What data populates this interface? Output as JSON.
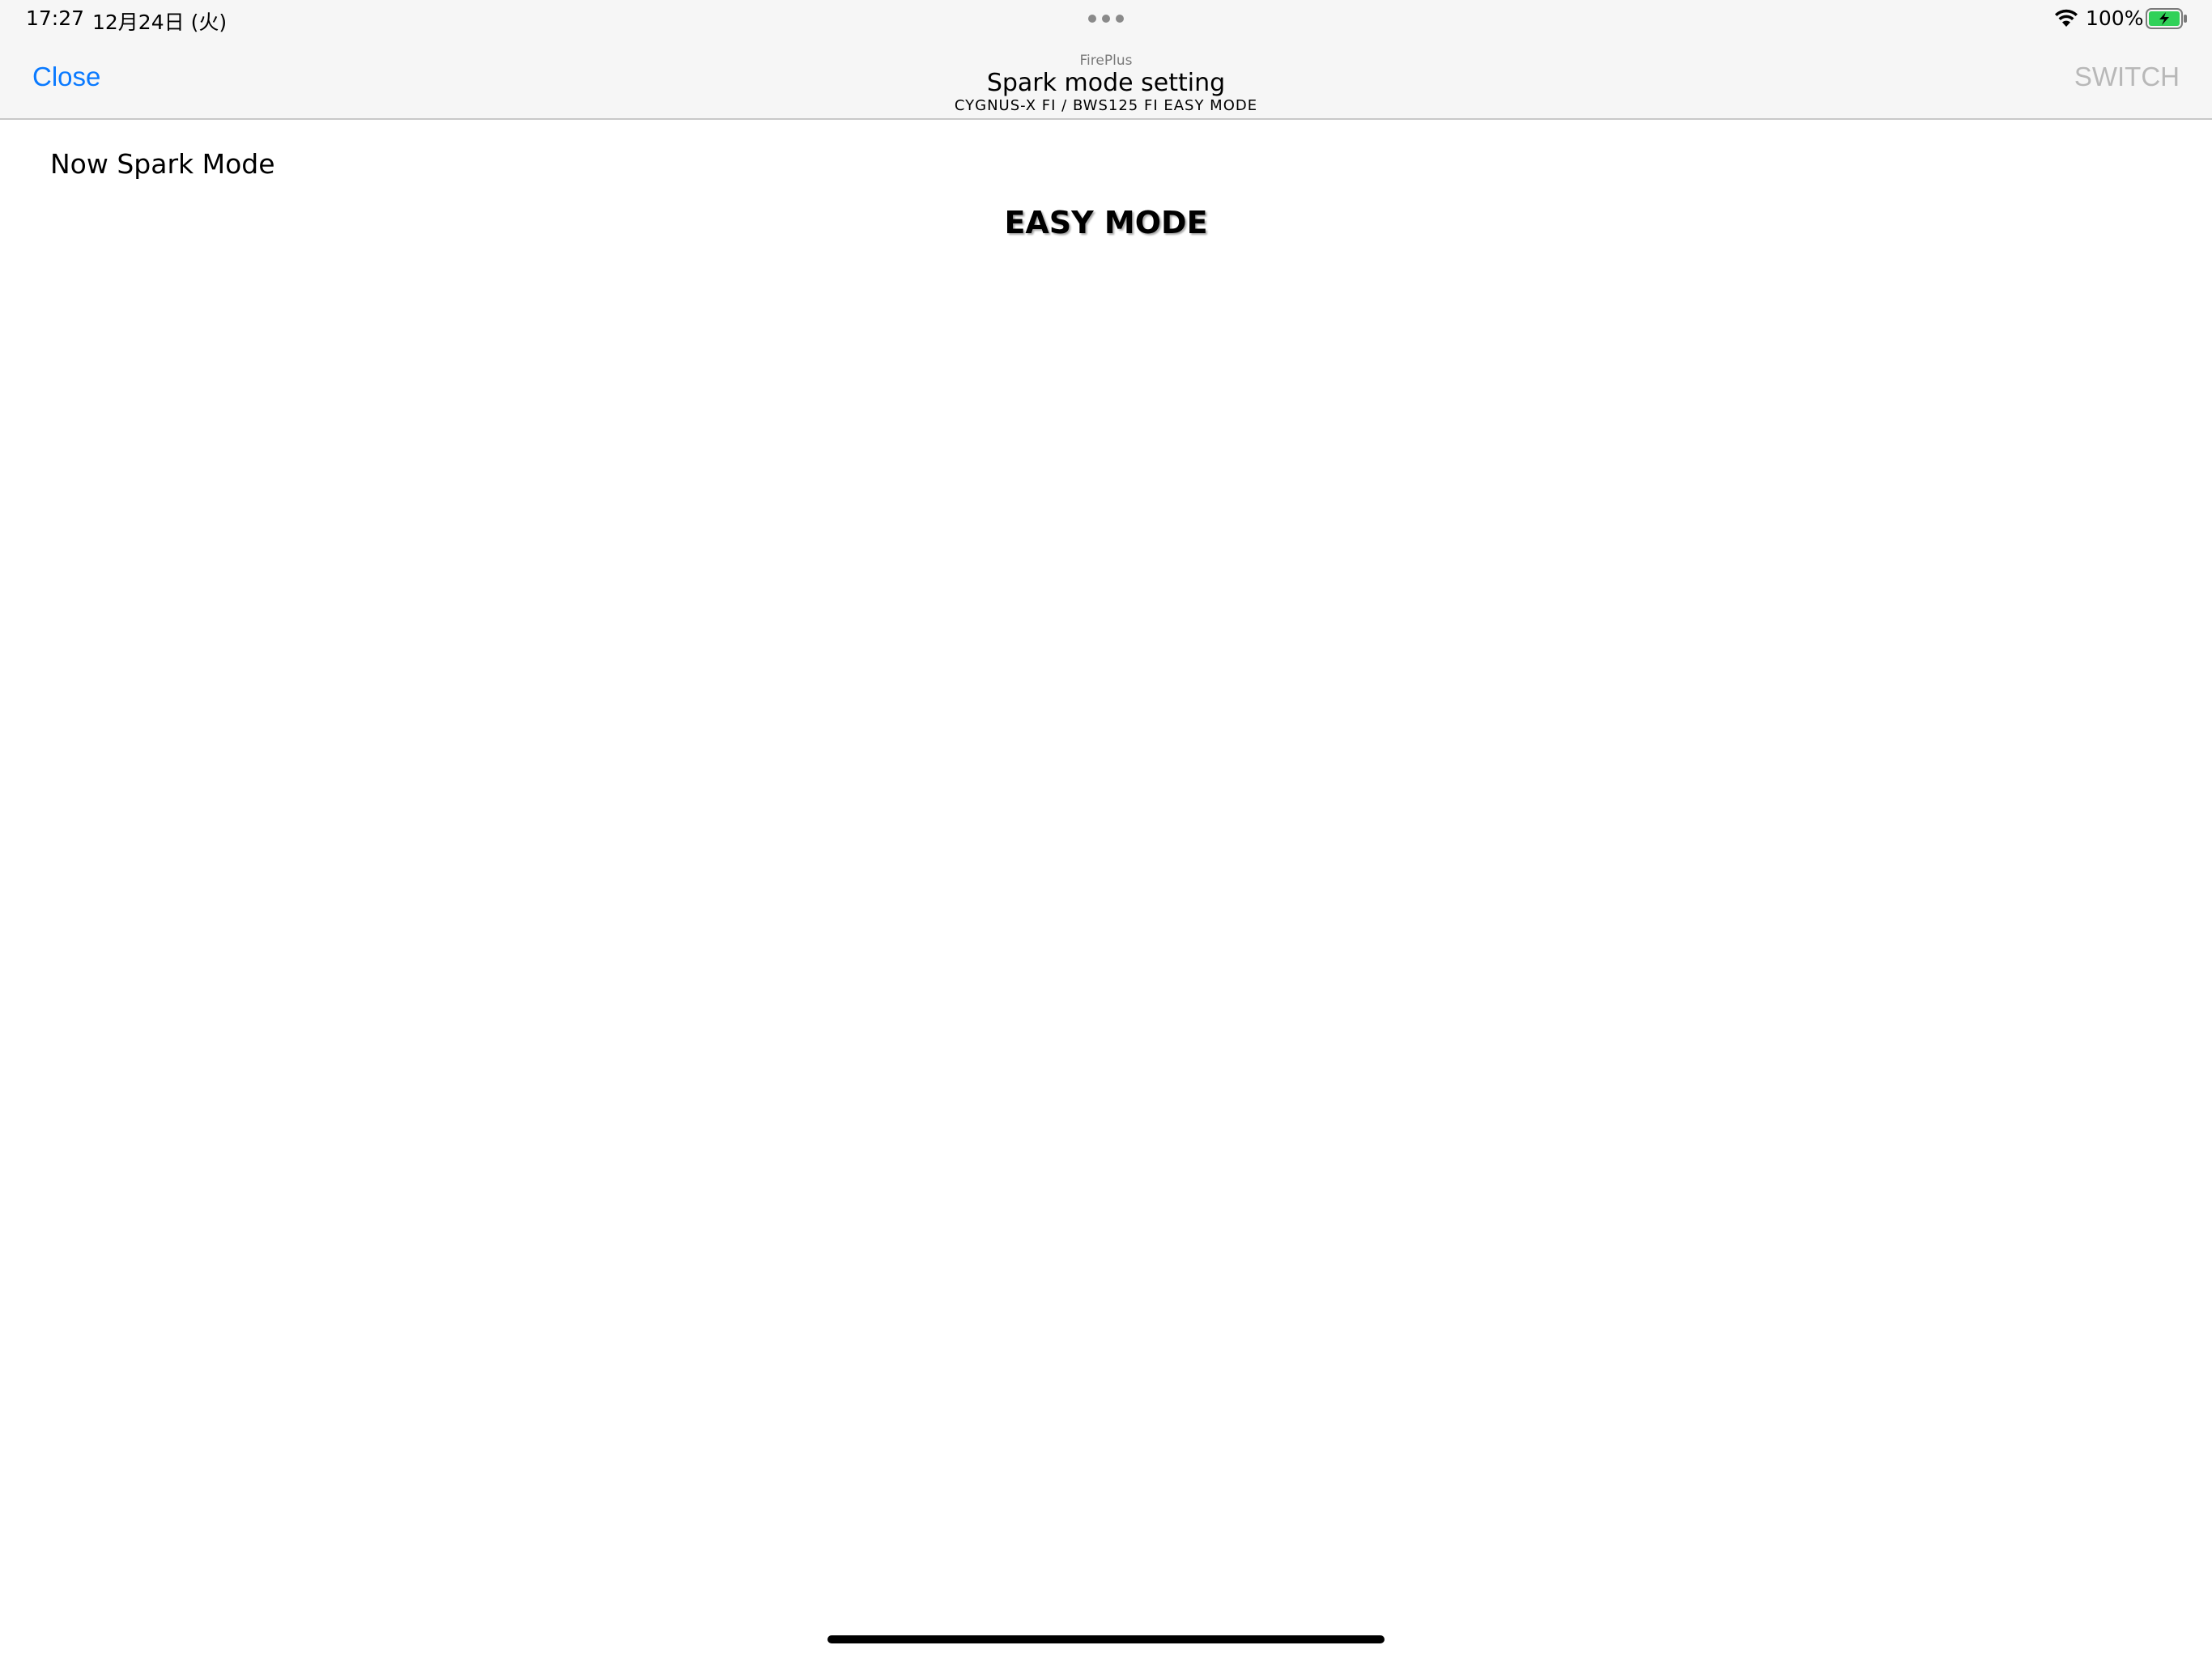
{
  "status_bar": {
    "time": "17:27",
    "date": "12月24日 (火)",
    "battery_percent": "100%",
    "wifi_icon": "wifi-icon",
    "battery_icon": "battery-charging-icon",
    "battery_color": "#30d158"
  },
  "nav_bar": {
    "close_label": "Close",
    "app_name": "FirePlus",
    "title": "Spark mode setting",
    "subtitle": "CYGNUS-X FI / BWS125 FI EASY MODE",
    "switch_label": "SWITCH",
    "accent_color": "#0a7aff",
    "disabled_color": "#b8b8b8"
  },
  "main": {
    "now_mode_label": "Now Spark Mode",
    "current_mode": "EASY MODE"
  }
}
